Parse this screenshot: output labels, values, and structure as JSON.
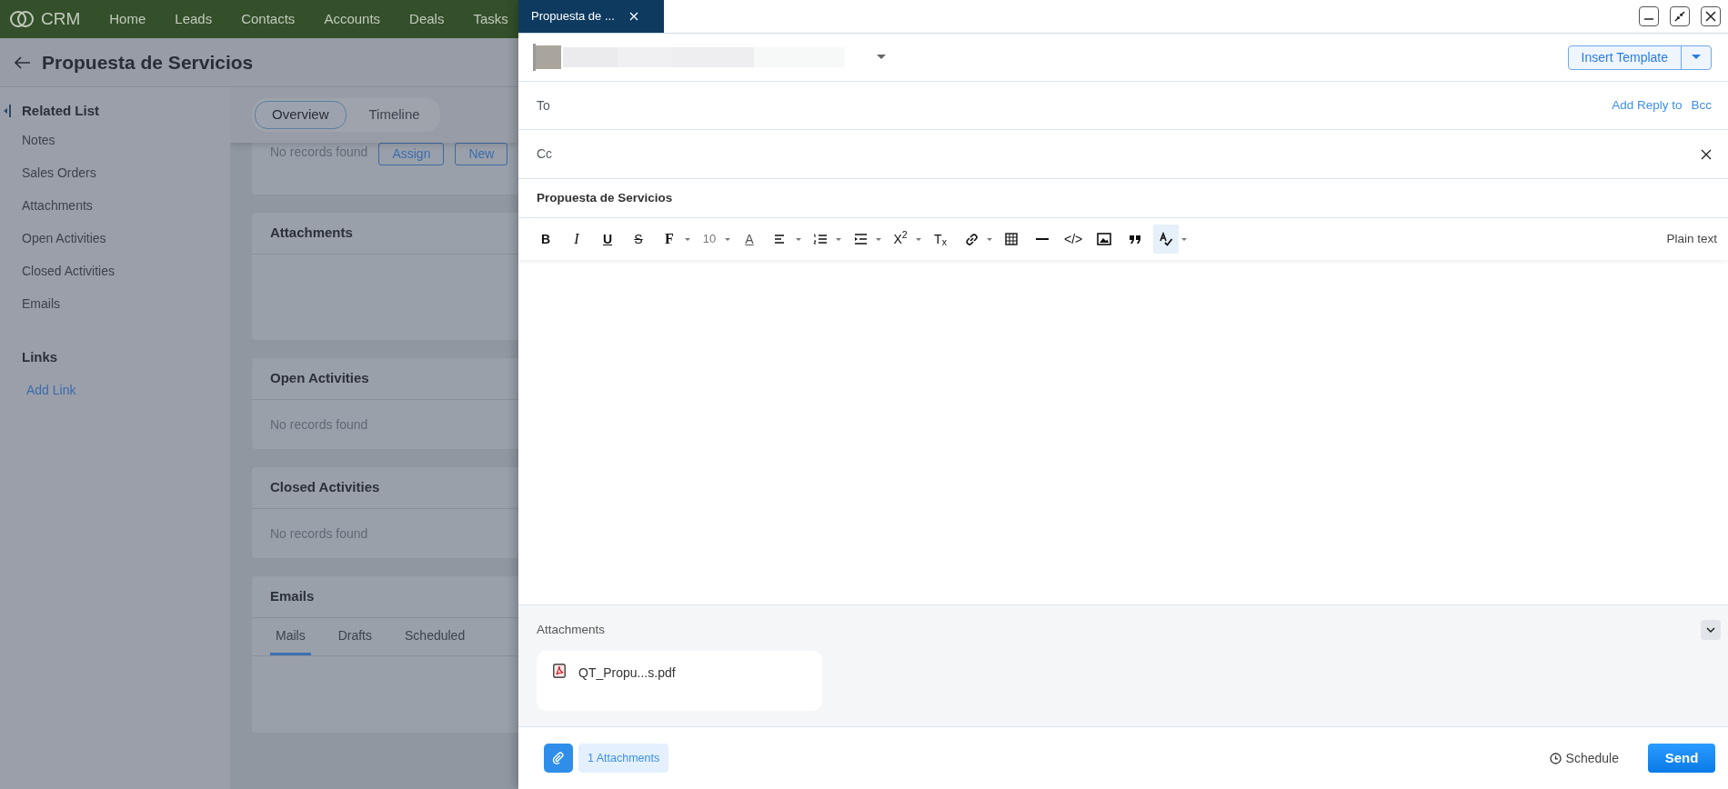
{
  "crm": {
    "logo": "CRM",
    "nav": [
      {
        "label": "Home"
      },
      {
        "label": "Leads"
      },
      {
        "label": "Contacts"
      },
      {
        "label": "Accounts"
      },
      {
        "label": "Deals"
      },
      {
        "label": "Tasks"
      }
    ],
    "title": "Propuesta de Servicios",
    "sidebar": {
      "heading": "Related List",
      "items": [
        "Notes",
        "Sales Orders",
        "Attachments",
        "Open Activities",
        "Closed Activities",
        "Emails"
      ],
      "links_heading": "Links",
      "add_link": "Add Link"
    },
    "view_tabs": [
      {
        "label": "Overview",
        "selected": true
      },
      {
        "label": "Timeline",
        "selected": false
      }
    ],
    "sections": [
      {
        "kind": "partial",
        "empty": "No records found",
        "buttons": [
          "Assign",
          "New"
        ]
      },
      {
        "kind": "blank",
        "title": "Attachments"
      },
      {
        "kind": "empty",
        "title": "Open Activities",
        "empty": "No records found"
      },
      {
        "kind": "empty",
        "title": "Closed Activities",
        "empty": "No records found"
      },
      {
        "kind": "tabs",
        "title": "Emails",
        "tabs": [
          {
            "label": "Mails",
            "selected": true
          },
          {
            "label": "Drafts",
            "selected": false
          },
          {
            "label": "Scheduled",
            "selected": false
          }
        ]
      }
    ]
  },
  "compose": {
    "tab_title": "Propuesta de ...",
    "insert_template": "Insert Template",
    "to_label": "To",
    "add_reply_to": "Add Reply to",
    "bcc": "Bcc",
    "cc_label": "Cc",
    "subject": "Propuesta de Servicios",
    "toolbar": [
      {
        "kind": "text",
        "label": "B",
        "dropdown": false,
        "active": false
      },
      {
        "kind": "text",
        "label": "I",
        "dropdown": false,
        "active": false
      },
      {
        "kind": "text",
        "label": "U",
        "dropdown": false,
        "active": false
      },
      {
        "kind": "text",
        "label": "S",
        "dropdown": false,
        "active": false
      },
      {
        "kind": "text",
        "label": "F",
        "dropdown": true,
        "active": false
      },
      {
        "kind": "text",
        "label": "10",
        "dropdown": true,
        "active": false
      },
      {
        "kind": "text",
        "label": "A",
        "dropdown": false,
        "active": false
      },
      {
        "kind": "icon",
        "dropdown": true,
        "active": false
      },
      {
        "kind": "icon",
        "dropdown": true,
        "active": false
      },
      {
        "kind": "icon",
        "dropdown": true,
        "active": false
      },
      {
        "kind": "text",
        "label": "X$^{2}$",
        "dropdown": true,
        "active": false
      },
      {
        "kind": "text",
        "label": "T$_{x}$",
        "dropdown": false,
        "active": false
      },
      {
        "kind": "icon",
        "dropdown": true,
        "active": false
      },
      {
        "kind": "icon",
        "dropdown": false,
        "active": false
      },
      {
        "kind": "icon",
        "dropdown": false,
        "active": false
      },
      {
        "kind": "text",
        "label": "</>",
        "dropdown": false,
        "active": false
      },
      {
        "kind": "icon",
        "dropdown": false,
        "active": false
      },
      {
        "kind": "icon",
        "dropdown": false,
        "active": false
      },
      {
        "kind": "icon",
        "dropdown": true,
        "active": true
      }
    ],
    "plain_text": "Plain text",
    "attachments_heading": "Attachments",
    "files": [
      {
        "name": "QT_Propu...s.pdf"
      }
    ],
    "attachments_count": "1 Attachments",
    "schedule": "Schedule",
    "send": "Send"
  }
}
